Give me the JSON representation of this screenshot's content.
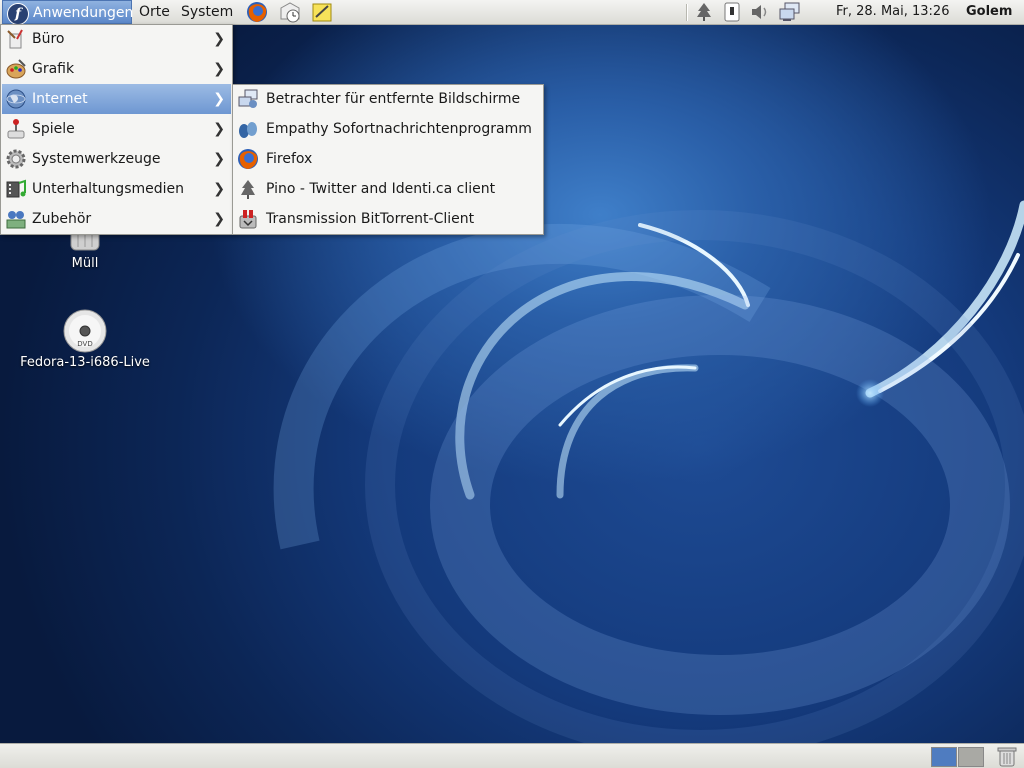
{
  "top_panel": {
    "menus": {
      "applications": "Anwendungen",
      "places": "Orte",
      "system": "System"
    },
    "launchers": [
      "firefox-icon",
      "email-clock-icon",
      "notes-icon"
    ],
    "tray": [
      "tree-icon",
      "usb-icon",
      "volume-icon",
      "network-icon"
    ],
    "clock": "Fr, 28. Mai, 13:26",
    "user": "Golem"
  },
  "desktop": {
    "icons": [
      {
        "label": "Müll",
        "icon": "trash-icon"
      },
      {
        "label": "Fedora-13-i686-Live",
        "icon": "dvd-icon"
      }
    ]
  },
  "applications_menu": {
    "items": [
      {
        "label": "Büro",
        "icon": "office-icon"
      },
      {
        "label": "Grafik",
        "icon": "graphics-icon"
      },
      {
        "label": "Internet",
        "icon": "internet-globe-icon",
        "active": true
      },
      {
        "label": "Spiele",
        "icon": "games-icon"
      },
      {
        "label": "Systemwerkzeuge",
        "icon": "system-tools-icon"
      },
      {
        "label": "Unterhaltungsmedien",
        "icon": "multimedia-icon"
      },
      {
        "label": "Zubehör",
        "icon": "accessories-icon"
      }
    ]
  },
  "internet_submenu": {
    "items": [
      {
        "label": "Betrachter für entfernte Bildschirme",
        "icon": "remote-desktop-icon"
      },
      {
        "label": "Empathy Sofortnachrichtenprogramm",
        "icon": "empathy-icon"
      },
      {
        "label": "Firefox",
        "icon": "firefox-icon"
      },
      {
        "label": "Pino - Twitter and Identi.ca client",
        "icon": "pino-tree-icon"
      },
      {
        "label": "Transmission BitTorrent-Client",
        "icon": "transmission-icon"
      }
    ]
  },
  "bottom_panel": {
    "workspaces": 2,
    "active_workspace": 1
  }
}
